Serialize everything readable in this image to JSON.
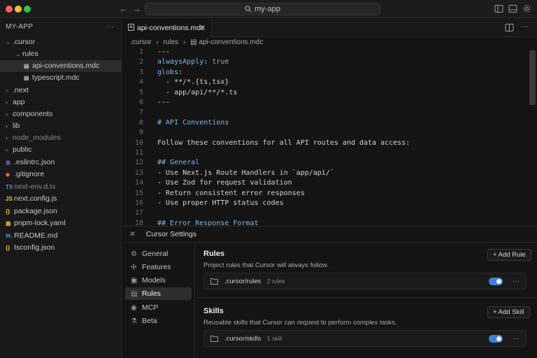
{
  "titlebar": {
    "search_text": "my-app",
    "back_glyph": "←",
    "forward_glyph": "→"
  },
  "sidebar": {
    "title": "MY-APP",
    "more_glyph": "···",
    "items": [
      {
        "label": ".cursor",
        "chevron": "⌄",
        "icon": "",
        "icon_name": "folder-open"
      },
      {
        "label": "rules",
        "chevron": "⌄",
        "icon": "",
        "icon_name": "folder-open"
      },
      {
        "label": "api-conventions.mdc",
        "chevron": "",
        "icon": "▤",
        "icon_name": "file-icon"
      },
      {
        "label": "typescript.mdc",
        "chevron": "",
        "icon": "▤",
        "icon_name": "file-icon"
      },
      {
        "label": ".next",
        "chevron": "›",
        "icon": "",
        "icon_name": "folder"
      },
      {
        "label": "app",
        "chevron": "›",
        "icon": "",
        "icon_name": "folder"
      },
      {
        "label": "components",
        "chevron": "›",
        "icon": "",
        "icon_name": "folder"
      },
      {
        "label": "lib",
        "chevron": "›",
        "icon": "",
        "icon_name": "folder"
      },
      {
        "label": "node_modules",
        "chevron": "›",
        "icon": "",
        "icon_name": "folder"
      },
      {
        "label": "public",
        "chevron": "›",
        "icon": "",
        "icon_name": "folder"
      },
      {
        "label": ".eslintrc.json",
        "chevron": "",
        "icon": "◎",
        "icon_name": "eslint-icon"
      },
      {
        "label": ".gitignore",
        "chevron": "",
        "icon": "◆",
        "icon_name": "git-icon"
      },
      {
        "label": "next-env.d.ts",
        "chevron": "",
        "icon": "TS",
        "icon_name": "typescript-icon"
      },
      {
        "label": "next.config.js",
        "chevron": "",
        "icon": "JS",
        "icon_name": "javascript-icon"
      },
      {
        "label": "package.json",
        "chevron": "",
        "icon": "{}",
        "icon_name": "json-icon"
      },
      {
        "label": "pnpm-lock.yaml",
        "chevron": "",
        "icon": "▦",
        "icon_name": "pnpm-icon"
      },
      {
        "label": "README.md",
        "chevron": "",
        "icon": "M↓",
        "icon_name": "markdown-icon"
      },
      {
        "label": "tsconfig.json",
        "chevron": "",
        "icon": "{}",
        "icon_name": "json-icon"
      }
    ]
  },
  "editor": {
    "tab_label": "api-conventions.mdc",
    "tab_close": "✕",
    "breadcrumb": [
      ".cursor",
      "rules",
      "api-conventions.mdc"
    ],
    "breadcrumb_sep": "›",
    "lines": [
      {
        "n": "1",
        "t": "---"
      },
      {
        "n": "2",
        "k": "alwaysApply",
        "p": ": ",
        "v": "true"
      },
      {
        "n": "3",
        "k": "globs",
        "p": ":"
      },
      {
        "n": "4",
        "t": "  - **/*.{ts,tsx}"
      },
      {
        "n": "5",
        "t": "  - app/api/**/*.ts"
      },
      {
        "n": "6",
        "t": "---"
      },
      {
        "n": "7",
        "t": ""
      },
      {
        "n": "8",
        "h": "# API Conventions"
      },
      {
        "n": "9",
        "t": ""
      },
      {
        "n": "10",
        "t": "Follow these conventions for all API routes and data access:"
      },
      {
        "n": "11",
        "t": ""
      },
      {
        "n": "12",
        "h": "## General"
      },
      {
        "n": "13",
        "t": "- Use Next.js Route Handlers in `app/api/`"
      },
      {
        "n": "14",
        "t": "- Use Zod for request validation"
      },
      {
        "n": "15",
        "t": "- Return consistent error responses"
      },
      {
        "n": "16",
        "t": "- Use proper HTTP status codes"
      },
      {
        "n": "17",
        "t": ""
      },
      {
        "n": "18",
        "h": "## Error Response Format"
      }
    ]
  },
  "settings": {
    "title": "Cursor Settings",
    "close_glyph": "✕",
    "nav": [
      {
        "label": "General",
        "icon": "⚙",
        "icon_name": "gear-icon"
      },
      {
        "label": "Features",
        "icon": "✣",
        "icon_name": "features-icon"
      },
      {
        "label": "Models",
        "icon": "▣",
        "icon_name": "models-icon"
      },
      {
        "label": "Rules",
        "icon": "▤",
        "icon_name": "rules-icon"
      },
      {
        "label": "MCP",
        "icon": "◉",
        "icon_name": "mcp-icon"
      },
      {
        "label": "Beta",
        "icon": "⚗",
        "icon_name": "beta-icon"
      }
    ],
    "rules": {
      "title": "Rules",
      "desc": "Project rules that Cursor will always follow.",
      "add_label": "+ Add Rule",
      "row_name": ".cursor/rules",
      "row_count": "2 rules",
      "enabled": true
    },
    "skills": {
      "title": "Skills",
      "desc": "Reusable skills that Cursor can request to perform complex tasks.",
      "add_label": "+ Add Skill",
      "row_name": ".cursor/skills",
      "row_count": "1 skill",
      "enabled": true
    },
    "row_more": "···"
  },
  "colors": {
    "accent": "#3d7fe0",
    "code_keyword": "#7fb5e8"
  }
}
